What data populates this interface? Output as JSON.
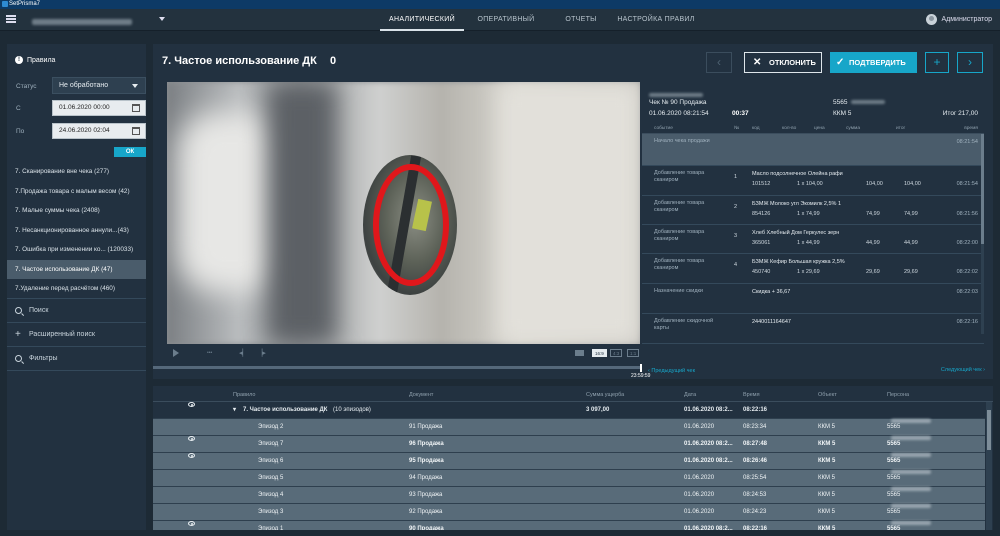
{
  "app": {
    "title": "SetPrisma7"
  },
  "nav": {
    "tabs": [
      "АНАЛИТИЧЕСКИЙ",
      "ОПЕРАТИВНЫЙ",
      "ОТЧЕТЫ",
      "НАСТРОЙКА ПРАВИЛ"
    ],
    "active_tab": 0,
    "user": "Администратор"
  },
  "sidebar": {
    "title": "Правила",
    "status_label": "Статус",
    "status_value": "Не обработано",
    "from_label": "С",
    "from_value": "01.06.2020 00:00",
    "to_label": "По",
    "to_value": "24.06.2020 02:04",
    "ok_label": "ОК",
    "rules": [
      "7. Сканирование вне чека (277)",
      "7.Продажа товара с малым весом (42)",
      "7. Малые суммы чека (2408)",
      "7. Несанкционированное аннули...(43)",
      "7. Ошибка при изменении ко... (120033)",
      "7. Частое использование ДК (47)",
      "7.Удаление перед расчётом (460)"
    ],
    "active_rule": 5,
    "search_label": "Поиск",
    "advanced_label": "Расширенный поиск",
    "filters_label": "Фильтры"
  },
  "main": {
    "title": "7. Частое использование ДК",
    "count": "0",
    "reject_label": "ОТКЛОНИТЬ",
    "confirm_label": "ПОДТВЕРДИТЬ",
    "prev_icon": "chevron-left-icon",
    "next_icon": "chevron-right-icon",
    "plus_icon": "plus-icon",
    "timeline_time": "23:59:59",
    "prev_check": "Предыдущий чек",
    "next_check": "Следующий чек",
    "aspect_options": [
      "16:9",
      "4:3",
      "1:1"
    ]
  },
  "receipt": {
    "check": "Чек № 90 Продажа",
    "datetime": "01.06.2020 08:21:54",
    "duration": "00:37",
    "person_id": "5565",
    "kkm": "ККМ 5",
    "total": "Итог 217,00",
    "headers": [
      "событие",
      "№",
      "код",
      "кол-во",
      "цена",
      "сумма",
      "итог",
      "время"
    ],
    "rows": [
      {
        "event": "Начало чека продажи",
        "num": "",
        "name": "",
        "code": "",
        "qty": "",
        "price": "",
        "sum": "",
        "total": "",
        "time": "08:21:54",
        "time2": "",
        "hl": true
      },
      {
        "event": "Добавление товара сканиром",
        "num": "1",
        "name": "Масло подсолнечное Олейна рафи",
        "code": "101512",
        "qty": "1 x 104,00",
        "price": "",
        "sum": "104,00",
        "total": "104,00",
        "time": "",
        "time2": "08:21:54"
      },
      {
        "event": "Добавление товара сканиром",
        "num": "2",
        "name": "БЗМЖ Молоко угл Экомилк 2,5% 1",
        "code": "854126",
        "qty": "1 x 74,99",
        "price": "",
        "sum": "74,99",
        "total": "74,99",
        "time": "",
        "time2": "08:21:56"
      },
      {
        "event": "Добавление товара сканиром",
        "num": "3",
        "name": "Хлеб Хлебный Дом Геркулес зерн",
        "code": "365061",
        "qty": "1 x 44,99",
        "price": "",
        "sum": "44,99",
        "total": "44,99",
        "time": "",
        "time2": "08:22:00"
      },
      {
        "event": "Добавление товара сканиром",
        "num": "4",
        "name": "БЗМЖ Кефир Большая кружка 2,5%",
        "code": "450740",
        "qty": "1 x 29,69",
        "price": "",
        "sum": "29,69",
        "total": "29,69",
        "time": "",
        "time2": "08:22:02"
      },
      {
        "event": "Назначение скидки",
        "num": "",
        "name": "Скидка + 36,67",
        "code": "",
        "qty": "",
        "price": "",
        "sum": "",
        "total": "",
        "time": "08:22:03",
        "time2": ""
      },
      {
        "event": "Добавление скидочной карты",
        "num": "",
        "name": "2440011164647",
        "code": "",
        "qty": "",
        "price": "",
        "sum": "",
        "total": "",
        "time": "08:22:16",
        "time2": ""
      }
    ]
  },
  "grid": {
    "headers": [
      "Правило",
      "Документ",
      "Сумма ущерба",
      "Дата",
      "Время",
      "Объект",
      "Персона"
    ],
    "group": {
      "rule": "7. Частое использование ДК",
      "episodes": "(10 эпизодов)",
      "sum": "3 097,00",
      "date": "01.06.2020 08:2...",
      "time": "08:22:16"
    },
    "rows": [
      {
        "episode": "Эпизод 2",
        "doc": "91 Продажа",
        "date": "01.06.2020",
        "time": "08:23:34",
        "obj": "ККМ 5",
        "person": "5565",
        "eye": false,
        "bold": false
      },
      {
        "episode": "Эпизод 7",
        "doc": "96 Продажа",
        "date": "01.06.2020 08:2...",
        "time": "08:27:48",
        "obj": "ККМ 5",
        "person": "5565",
        "eye": true,
        "bold": true
      },
      {
        "episode": "Эпизод 6",
        "doc": "95 Продажа",
        "date": "01.06.2020 08:2...",
        "time": "08:26:46",
        "obj": "ККМ 5",
        "person": "5565",
        "eye": true,
        "bold": true
      },
      {
        "episode": "Эпизод 5",
        "doc": "94 Продажа",
        "date": "01.06.2020",
        "time": "08:25:54",
        "obj": "ККМ 5",
        "person": "5565",
        "eye": false,
        "bold": false
      },
      {
        "episode": "Эпизод 4",
        "doc": "93 Продажа",
        "date": "01.06.2020",
        "time": "08:24:53",
        "obj": "ККМ 5",
        "person": "5565",
        "eye": false,
        "bold": false
      },
      {
        "episode": "Эпизод 3",
        "doc": "92 Продажа",
        "date": "01.06.2020",
        "time": "08:24:23",
        "obj": "ККМ 5",
        "person": "5565",
        "eye": false,
        "bold": false
      },
      {
        "episode": "Эпизод 1",
        "doc": "90 Продажа",
        "date": "01.06.2020 08:2...",
        "time": "08:22:16",
        "obj": "ККМ 5",
        "person": "5565",
        "eye": true,
        "bold": true
      }
    ]
  },
  "colors": {
    "accent": "#17a6c9",
    "danger": "#e0171b",
    "bg": "#1d2a35",
    "panel": "#223140"
  }
}
